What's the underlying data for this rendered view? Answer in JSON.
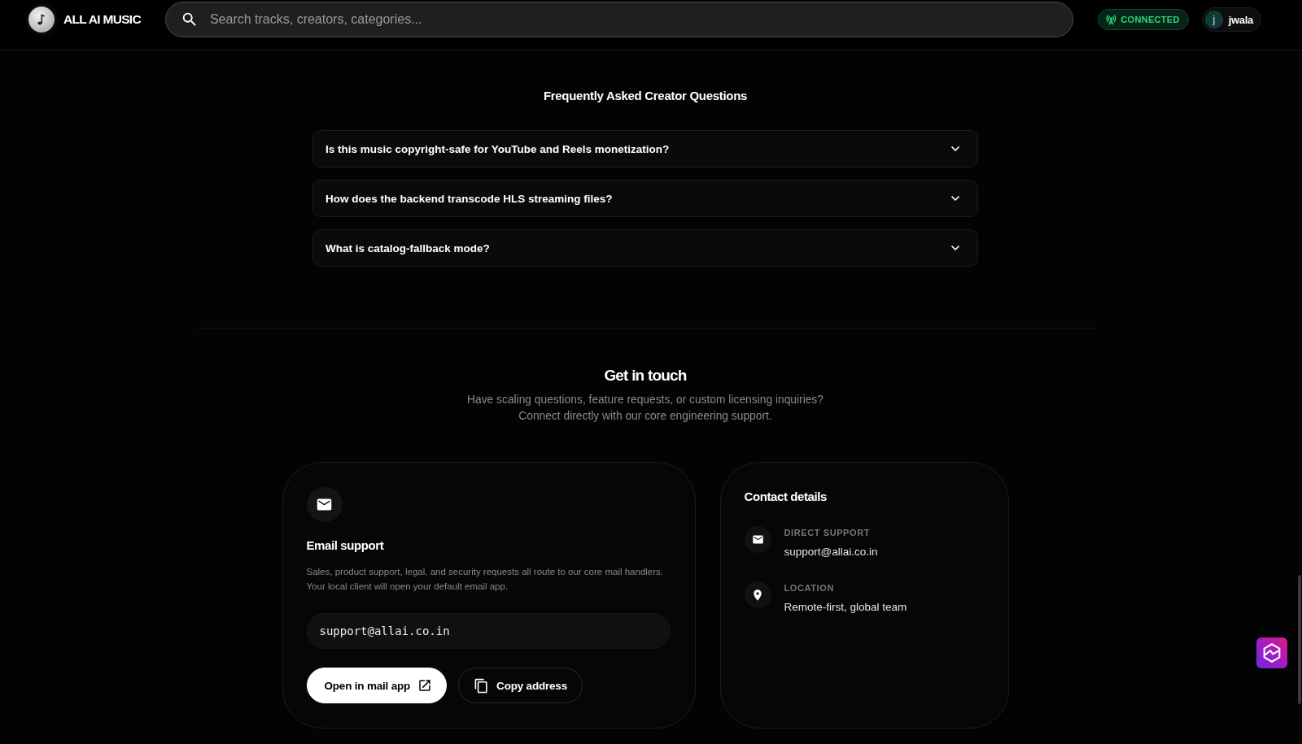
{
  "header": {
    "brand": "ALL AI MUSIC",
    "search": {
      "placeholder": "Search tracks, creators, categories..."
    },
    "status": {
      "label": "CONNECTED",
      "connected": true
    },
    "user": {
      "initial": "j",
      "name": "jwala"
    }
  },
  "faq": {
    "title": "Frequently Asked Creator Questions",
    "items": [
      {
        "question": "Is this music copyright-safe for YouTube and Reels monetization?",
        "expanded": false
      },
      {
        "question": "How does the backend transcode HLS streaming files?",
        "expanded": false
      },
      {
        "question": "What is catalog-fallback mode?",
        "expanded": false
      }
    ]
  },
  "contact": {
    "title": "Get in touch",
    "subtitle": "Have scaling questions, feature requests, or custom licensing inquiries? Connect directly with our core engineering support.",
    "email_card": {
      "title": "Email support",
      "description": "Sales, product support, legal, and security requests all route to our core mail handlers. Your local client will open your default email app.",
      "address": "support@allai.co.in",
      "buttons": [
        {
          "label": "Open in mail app",
          "kind": "primary"
        },
        {
          "label": "Copy address",
          "kind": "secondary"
        }
      ]
    },
    "details_card": {
      "title": "Contact details",
      "items": [
        {
          "kind": "email",
          "label": "DIRECT SUPPORT",
          "value": "support@allai.co.in"
        },
        {
          "kind": "location",
          "label": "LOCATION",
          "value": "Remote-first, global team"
        }
      ]
    }
  }
}
